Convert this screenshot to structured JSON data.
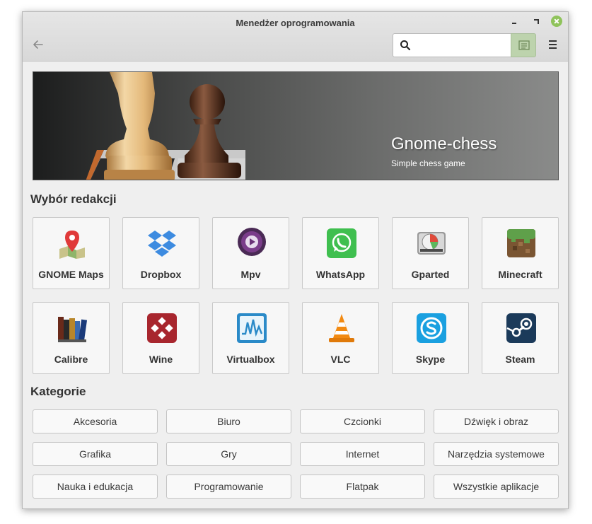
{
  "window": {
    "title": "Menedżer oprogramowania"
  },
  "header": {
    "search": {
      "value": "",
      "placeholder": ""
    }
  },
  "banner": {
    "title": "Gnome-chess",
    "subtitle": "Simple chess game"
  },
  "picks": {
    "title": "Wybór redakcji",
    "apps": [
      {
        "label": "GNOME Maps",
        "icon": "map-pin-icon"
      },
      {
        "label": "Dropbox",
        "icon": "dropbox-icon"
      },
      {
        "label": "Mpv",
        "icon": "play-icon"
      },
      {
        "label": "WhatsApp",
        "icon": "whatsapp-icon"
      },
      {
        "label": "Gparted",
        "icon": "disk-icon"
      },
      {
        "label": "Minecraft",
        "icon": "grass-block-icon"
      },
      {
        "label": "Calibre",
        "icon": "books-icon"
      },
      {
        "label": "Wine",
        "icon": "wine-icon"
      },
      {
        "label": "Virtualbox",
        "icon": "virtualbox-icon"
      },
      {
        "label": "VLC",
        "icon": "traffic-cone-icon"
      },
      {
        "label": "Skype",
        "icon": "skype-icon"
      },
      {
        "label": "Steam",
        "icon": "steam-icon"
      }
    ]
  },
  "categories": {
    "title": "Kategorie",
    "items": [
      "Akcesoria",
      "Biuro",
      "Czcionki",
      "Dźwięk i obraz",
      "Grafika",
      "Gry",
      "Internet",
      "Narzędzia systemowe",
      "Nauka i edukacja",
      "Programowanie",
      "Flatpak",
      "Wszystkie aplikacje"
    ]
  },
  "colors": {
    "accent": "#8fc35b",
    "search_button": "#bdd3ad",
    "window_bg": "#efefef"
  }
}
